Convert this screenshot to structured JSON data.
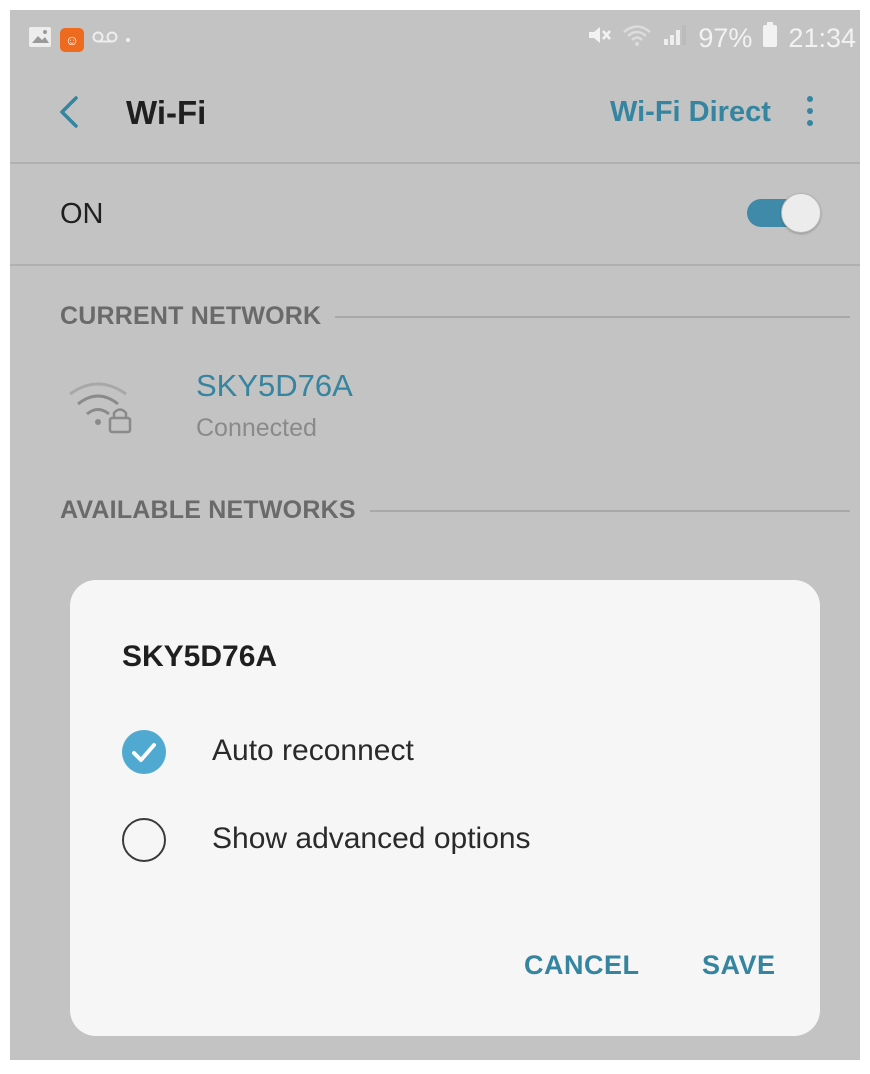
{
  "status_bar": {
    "battery": "97%",
    "time": "21:34",
    "icons": [
      "gallery-icon",
      "app-notification-icon",
      "voicemail-icon",
      "mute-icon",
      "wifi-signal-icon",
      "cell-signal-icon",
      "battery-icon"
    ]
  },
  "header": {
    "title": "Wi-Fi",
    "wifi_direct_label": "Wi-Fi Direct",
    "back_icon": "back-chevron-icon",
    "more_icon": "more-vert-icon"
  },
  "wifi_toggle": {
    "label": "ON",
    "state": "on",
    "accent_color": "#3f8aa8"
  },
  "current_network": {
    "section_label": "CURRENT NETWORK",
    "name": "SKY5D76A",
    "status": "Connected",
    "icon": "wifi-lock-icon"
  },
  "available_networks": {
    "section_label": "AVAILABLE NETWORKS"
  },
  "dialog": {
    "title": "SKY5D76A",
    "options": [
      {
        "label": "Auto reconnect",
        "checked": true
      },
      {
        "label": "Show advanced options",
        "checked": false
      }
    ],
    "cancel_label": "CANCEL",
    "save_label": "SAVE"
  },
  "colors": {
    "accent": "#3584a0",
    "checkbox_checked": "#4fa9d0",
    "screen_bg": "#c3c3c3",
    "dialog_bg": "#f6f6f6"
  }
}
